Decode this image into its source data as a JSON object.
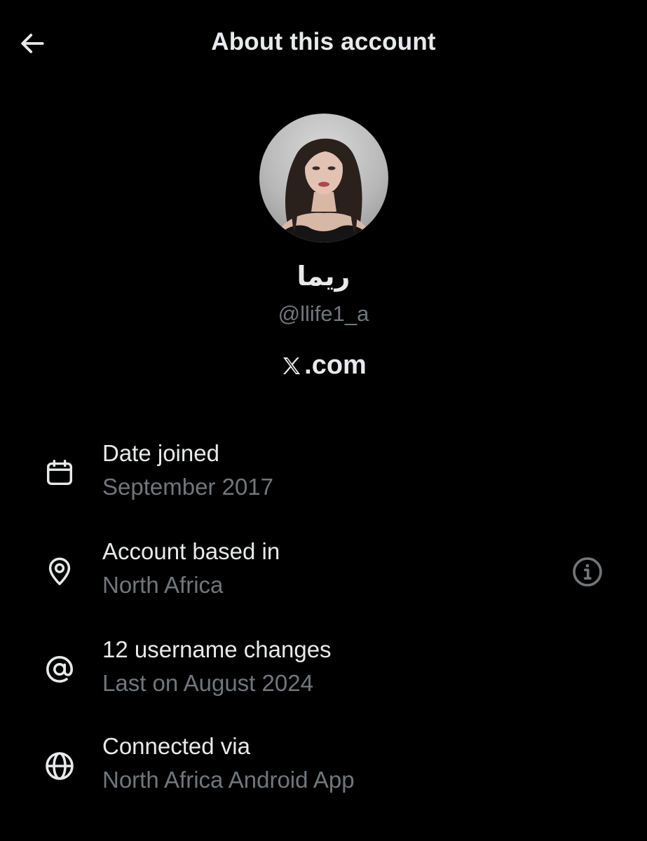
{
  "header": {
    "title": "About this account",
    "back_icon": "arrow-left-icon"
  },
  "profile": {
    "display_name": "ريما",
    "handle": "@llife1_a",
    "site_text": ".com",
    "site_logo": "x-logo"
  },
  "details": [
    {
      "icon": "calendar-icon",
      "label": "Date joined",
      "value": "September 2017"
    },
    {
      "icon": "location-pin-icon",
      "label": "Account based in",
      "value": "North Africa",
      "info_icon": "info-icon"
    },
    {
      "icon": "at-sign-icon",
      "label": "12 username changes",
      "value": "Last on August 2024"
    },
    {
      "icon": "globe-icon",
      "label": "Connected via",
      "value": "North Africa Android App"
    }
  ],
  "colors": {
    "background": "#000000",
    "primary_text": "#e7e9ea",
    "secondary_text": "#71767b"
  }
}
